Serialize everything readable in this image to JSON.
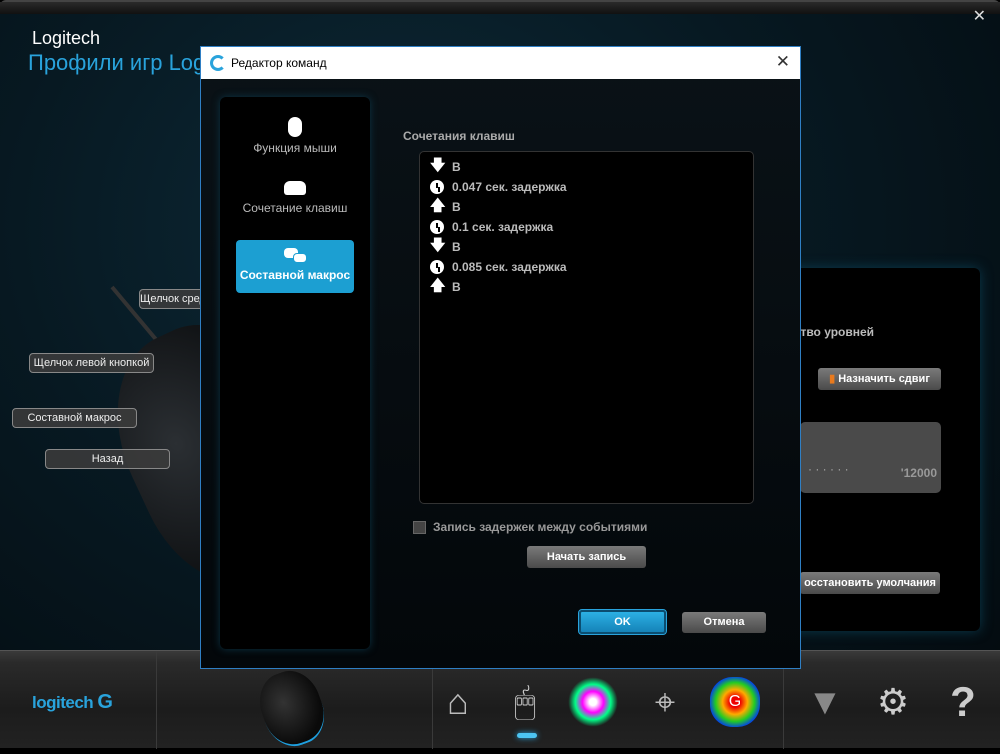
{
  "app": {
    "brand": "Logitech",
    "title": "Профили игр Logitech",
    "close": "✕"
  },
  "mouse_labels": [
    "Щелчок средней кнопкой",
    "Щелчок левой кнопкой",
    "Составной макрос",
    "Назад"
  ],
  "right_panel": {
    "levels_label": "нество уровней",
    "shift_button": "Назначить сдвиг",
    "dpi_value": "'12000",
    "dots": "·  ·  ·  ·  ·  ·",
    "restore_button": "осстановить умолчания"
  },
  "footer": {
    "logo": "logitech",
    "logo_mark": "G"
  },
  "dialog": {
    "title": "Редактор команд",
    "close": "✕",
    "modes": [
      {
        "label": "Функция мыши",
        "icon": "mouse-icon"
      },
      {
        "label": "Сочетание клавиш",
        "icon": "key-icon"
      },
      {
        "label": "Составной макрос",
        "icon": "keys-icon",
        "selected": true
      }
    ],
    "section_label": "Сочетания клавиш",
    "events": [
      {
        "type": "down",
        "text": "B"
      },
      {
        "type": "delay",
        "text": "0.047 сек. задержка"
      },
      {
        "type": "up",
        "text": "B"
      },
      {
        "type": "delay",
        "text": "0.1 сек. задержка"
      },
      {
        "type": "down",
        "text": "B"
      },
      {
        "type": "delay",
        "text": "0.085 сек. задержка"
      },
      {
        "type": "up",
        "text": "B"
      }
    ],
    "record_delays_label": "Запись задержек между событиями",
    "record_delays_checked": false,
    "start_record": "Начать запись",
    "ok": "OK",
    "cancel": "Отмена"
  }
}
